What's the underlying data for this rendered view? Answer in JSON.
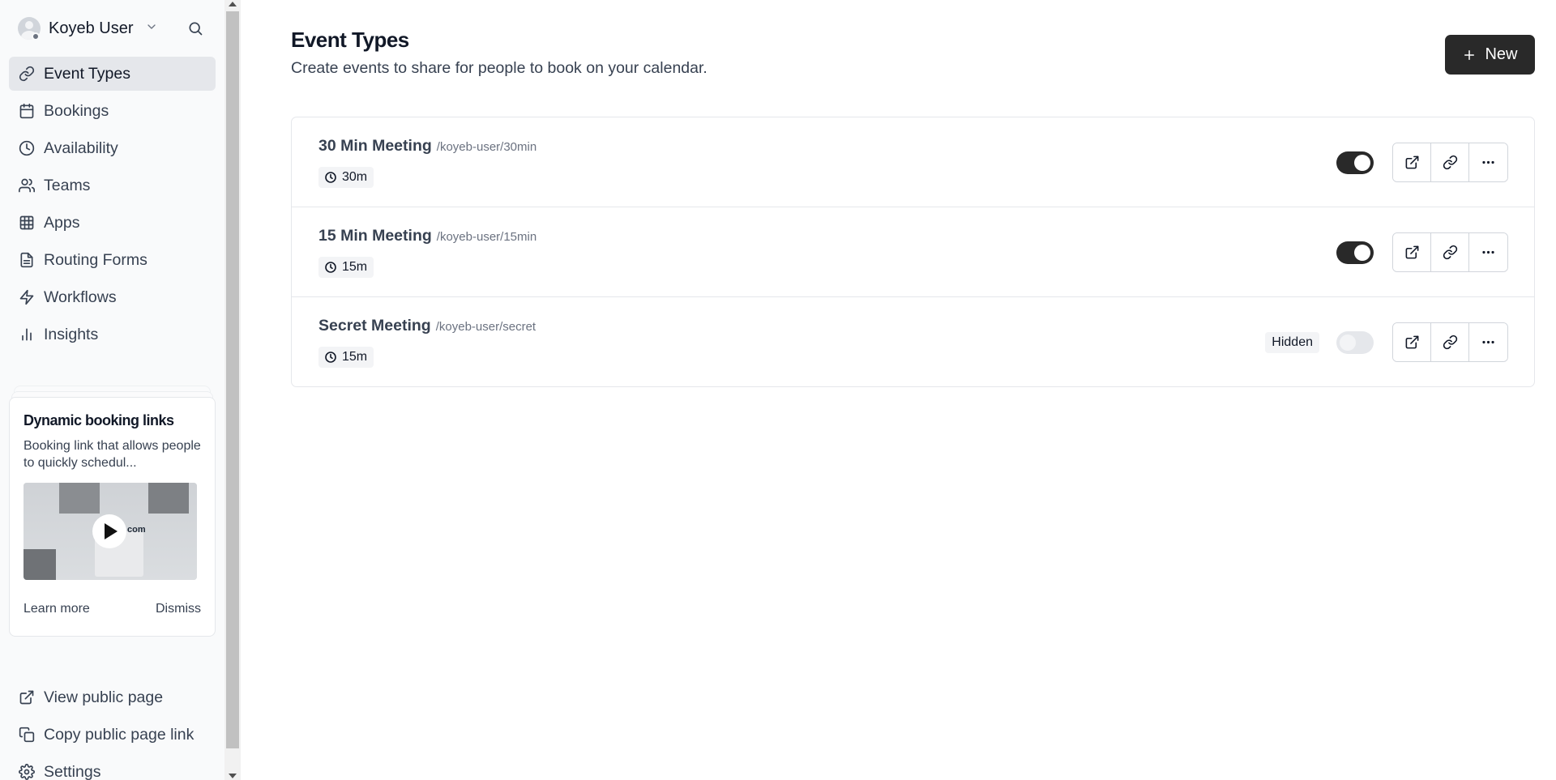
{
  "user": {
    "name": "Koyeb User"
  },
  "nav": {
    "items": [
      {
        "label": "Event Types",
        "icon": "link-icon",
        "active": true
      },
      {
        "label": "Bookings",
        "icon": "calendar-icon"
      },
      {
        "label": "Availability",
        "icon": "clock-icon"
      },
      {
        "label": "Teams",
        "icon": "users-icon"
      },
      {
        "label": "Apps",
        "icon": "grid-icon"
      },
      {
        "label": "Routing Forms",
        "icon": "file-text-icon"
      },
      {
        "label": "Workflows",
        "icon": "zap-icon"
      },
      {
        "label": "Insights",
        "icon": "bar-chart-icon"
      }
    ]
  },
  "promo": {
    "title": "Dynamic booking links",
    "description": "Booking link that allows people to quickly schedul...",
    "video_brand": "com",
    "learn_more": "Learn more",
    "dismiss": "Dismiss"
  },
  "bottom_nav": {
    "view_public": "View public page",
    "copy_link": "Copy public page link",
    "settings": "Settings"
  },
  "page": {
    "title": "Event Types",
    "subtitle": "Create events to share for people to book on your calendar.",
    "new_button": "New"
  },
  "events": [
    {
      "name": "30 Min Meeting",
      "slug": "/koyeb-user/30min",
      "duration": "30m",
      "enabled": true,
      "hidden_label": ""
    },
    {
      "name": "15 Min Meeting",
      "slug": "/koyeb-user/15min",
      "duration": "15m",
      "enabled": true,
      "hidden_label": ""
    },
    {
      "name": "Secret Meeting",
      "slug": "/koyeb-user/secret",
      "duration": "15m",
      "enabled": false,
      "hidden_label": "Hidden"
    }
  ],
  "colors": {
    "primary": "#292929",
    "active_nav": "#e5e7eb",
    "sidebar_bg": "#f9fafb"
  }
}
